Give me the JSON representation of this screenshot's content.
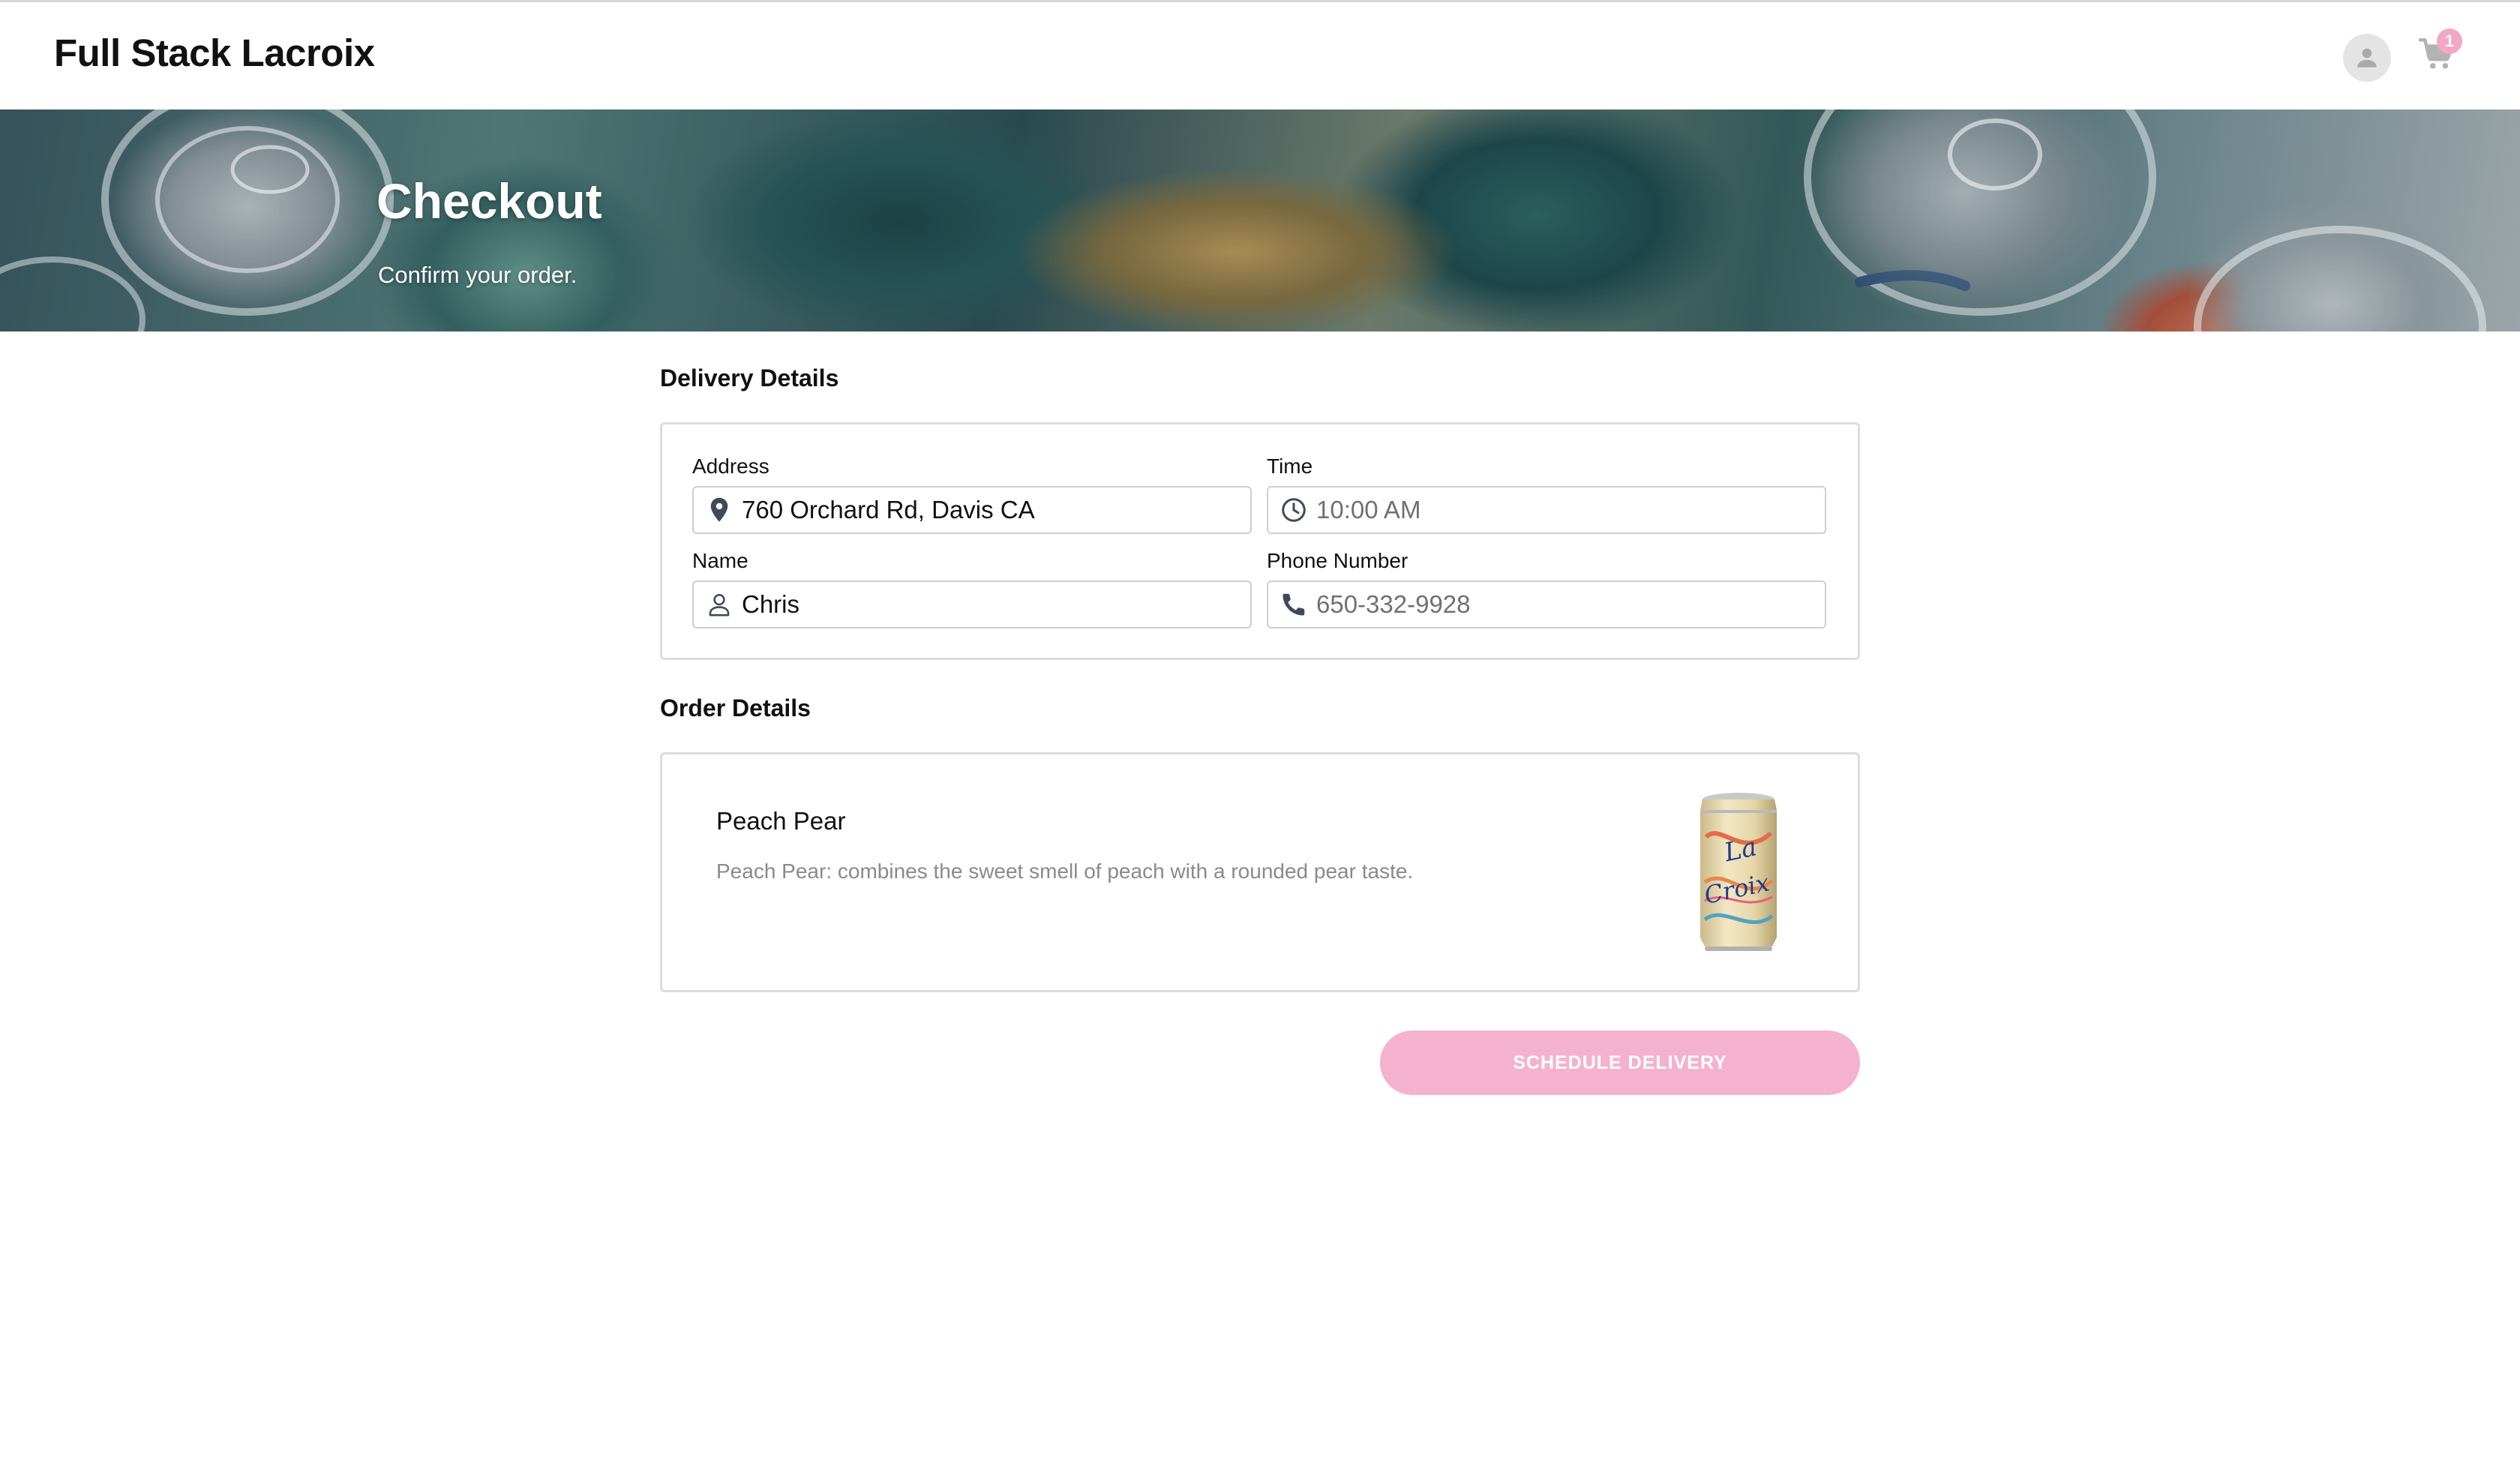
{
  "header": {
    "brand": "Full Stack Lacroix",
    "cart_count": "1",
    "icons": {
      "profile": "user-avatar-icon",
      "cart": "shopping-cart-icon"
    }
  },
  "hero": {
    "title": "Checkout",
    "subtitle": "Confirm your order."
  },
  "delivery": {
    "section_title": "Delivery Details",
    "address_label": "Address",
    "address_value": "760 Orchard Rd, Davis CA",
    "time_label": "Time",
    "time_placeholder": "10:00 AM",
    "name_label": "Name",
    "name_value": "Chris",
    "phone_label": "Phone Number",
    "phone_placeholder": "650-332-9928"
  },
  "order": {
    "section_title": "Order Details",
    "product_name": "Peach Pear",
    "product_description": "Peach Pear: combines the sweet smell of peach with a rounded pear taste."
  },
  "actions": {
    "schedule_label": "SCHEDULE DELIVERY"
  },
  "colors": {
    "accent_pink": "#f5b2cf",
    "badge_pink": "#f2a7c6",
    "icon_slate": "#3f4a5a"
  }
}
